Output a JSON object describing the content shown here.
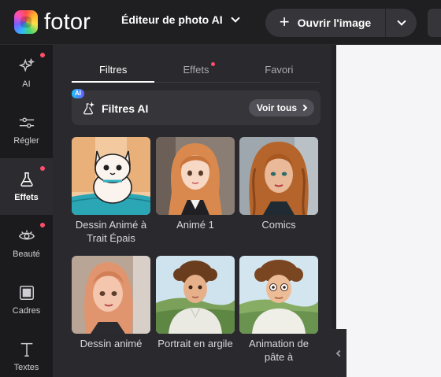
{
  "app": {
    "logo_text": "fotor",
    "editor_switch_label": "Éditeur de photo AI",
    "open_button_label": "Ouvrir l'image",
    "accent": "#ff4d6d"
  },
  "rail": {
    "items": [
      {
        "label": "AI",
        "icon": "sparkles-icon",
        "dot": true
      },
      {
        "label": "Régler",
        "icon": "sliders-icon",
        "dot": false
      },
      {
        "label": "Effets",
        "icon": "flask-icon",
        "dot": true,
        "active": true
      },
      {
        "label": "Beauté",
        "icon": "eye-icon",
        "dot": true
      },
      {
        "label": "Cadres",
        "icon": "frame-icon",
        "dot": false
      },
      {
        "label": "Textes",
        "icon": "text-icon",
        "dot": false
      }
    ]
  },
  "panel": {
    "tabs": [
      {
        "label": "Filtres",
        "active": true
      },
      {
        "label": "Effets",
        "dot": true
      },
      {
        "label": "Favori"
      }
    ],
    "ai_badge": "AI",
    "section_title": "Filtres AI",
    "see_all_label": "Voir tous",
    "cards": [
      {
        "label": "Dessin Animé à Trait Épais",
        "thumb": "cartoon-cat"
      },
      {
        "label": "Animé 1",
        "thumb": "anime-girl"
      },
      {
        "label": "Comics",
        "thumb": "comics-woman"
      },
      {
        "label": "Dessin animé",
        "thumb": "cartoon-girl"
      },
      {
        "label": "Portrait en argile",
        "thumb": "clay-man"
      },
      {
        "label": "Animation de pâte à",
        "thumb": "clay-animation-man"
      }
    ]
  }
}
